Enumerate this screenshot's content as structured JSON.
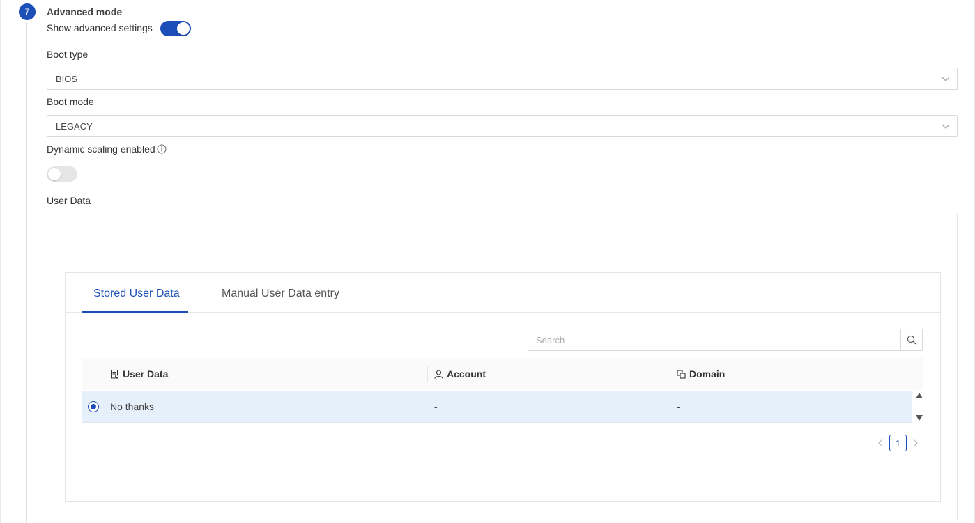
{
  "step": {
    "number": "7",
    "title": "Advanced mode"
  },
  "advanced": {
    "label": "Show advanced settings",
    "enabled": true
  },
  "boot_type": {
    "label": "Boot type",
    "value": "BIOS"
  },
  "boot_mode": {
    "label": "Boot mode",
    "value": "LEGACY"
  },
  "dynamic_scaling": {
    "label": "Dynamic scaling enabled",
    "enabled": false
  },
  "user_data": {
    "label": "User Data",
    "tabs": [
      {
        "label": "Stored User Data",
        "active": true
      },
      {
        "label": "Manual User Data entry",
        "active": false
      }
    ],
    "search": {
      "placeholder": "Search",
      "value": ""
    },
    "columns": [
      "User Data",
      "Account",
      "Domain"
    ],
    "rows": [
      {
        "selected": true,
        "user_data": "No thanks",
        "account": "-",
        "domain": "-"
      }
    ],
    "pagination": {
      "current": "1"
    }
  },
  "colors": {
    "accent": "#1d4fb8",
    "selected_row": "#e6f0fa"
  },
  "icons": [
    "info-icon",
    "chevron-down-icon",
    "search-icon",
    "document-icon",
    "user-icon",
    "domain-icon",
    "caret-up-icon",
    "caret-down-icon",
    "chevron-left-icon",
    "chevron-right-icon"
  ]
}
